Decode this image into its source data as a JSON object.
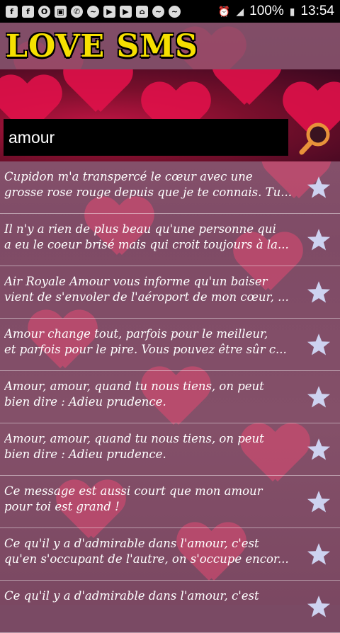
{
  "status_bar": {
    "notification_icons": [
      "facebook-icon",
      "facebook-messenger-icon",
      "opera-icon",
      "gallery-icon",
      "whatsapp-icon",
      "messenger-icon",
      "youtube-icon",
      "youtube-icon",
      "home-icon",
      "messenger-icon",
      "messenger-icon"
    ],
    "alarm_icon": "alarm-icon",
    "signal_icon": "signal-icon",
    "battery": "100%",
    "time": "13:54"
  },
  "header": {
    "title": "LOVE SMS"
  },
  "search": {
    "value": "amour"
  },
  "colors": {
    "accent_yellow": "#f6e000",
    "search_bg": "#000000",
    "heart_pink": "#e24a72"
  },
  "messages": [
    {
      "text": "Cupidon m'a transpercé le cœur avec une\ngrosse rose rouge depuis que je te connais. Tu..."
    },
    {
      "text": "Il n'y a rien de plus beau qu'une personne qui\na eu le coeur brisé mais qui croit toujours à la..."
    },
    {
      "text": "Air Royale Amour vous informe qu'un baiser\nvient de s'envoler de l'aéroport de mon cœur, ..."
    },
    {
      "text": "Amour change tout, parfois pour le meilleur,\net parfois pour le pire. Vous pouvez être sûr c..."
    },
    {
      "text": "Amour, amour, quand tu nous tiens, on peut\nbien dire : Adieu prudence."
    },
    {
      "text": "Amour, amour, quand tu nous tiens, on peut\nbien dire : Adieu prudence."
    },
    {
      "text": "Ce message est aussi court que mon amour\npour toi est grand !"
    },
    {
      "text": "Ce qu'il y a d'admirable dans l'amour, c'est\nqu'en s'occupant de l'autre, on s'occupe encor..."
    },
    {
      "text": "Ce qu'il y a d'admirable dans l'amour, c'est"
    }
  ]
}
